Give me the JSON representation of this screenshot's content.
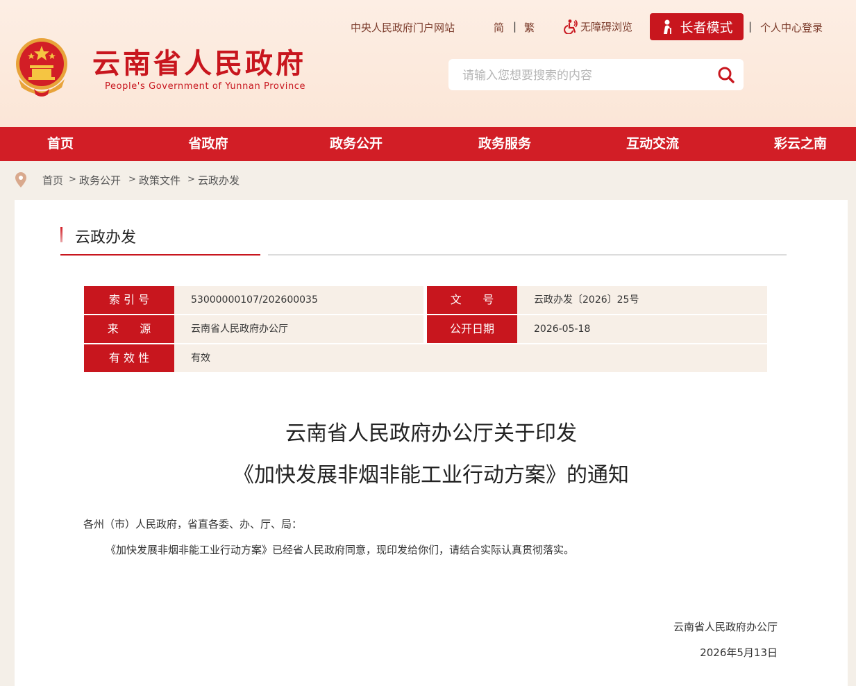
{
  "header": {
    "site_title": "云南省人民政府",
    "site_subtitle": "People's Government of Yunnan Province",
    "top_links": {
      "central_portal": "中央人民政府门户网站",
      "simplified": "简",
      "traditional": "繁",
      "accessibility": "无障碍浏览",
      "elder_mode": "长者模式",
      "login": "个人中心登录"
    },
    "search": {
      "placeholder": "请输入您想要搜索的内容",
      "value": ""
    }
  },
  "nav": {
    "items": [
      "首页",
      "省政府",
      "政务公开",
      "政务服务",
      "互动交流",
      "彩云之南"
    ]
  },
  "breadcrumb": [
    "首页",
    "政务公开",
    "政策文件",
    "云政办发"
  ],
  "column_title": "云政办发",
  "meta": {
    "index_label": "索 引 号",
    "index_value": "53000000107/202600035",
    "doc_no_label": "文      号",
    "doc_no_value": "云政办发〔2026〕25号",
    "source_label": "来      源",
    "source_value": "云南省人民政府办公厅",
    "date_label": "公开日期",
    "date_value": "2026-05-18",
    "validity_label": "有 效 性",
    "validity_value": "有效"
  },
  "document": {
    "title_line1": "云南省人民政府办公厅关于印发",
    "title_line2": "《加快发展非烟非能工业行动方案》的通知",
    "salutation": "各州（市）人民政府，省直各委、办、厅、局：",
    "paragraph1": "《加快发展非烟非能工业行动方案》已经省人民政府同意，现印发给你们，请结合实际认真贯彻落实。",
    "signer": "云南省人民政府办公厅",
    "sign_date": "2026年5月13日"
  },
  "colors": {
    "brand_red": "#c8161e",
    "nav_red": "#d21e26",
    "header_bg": "#fbe6d7",
    "meta_bg": "#f7efe7"
  },
  "icons": [
    "national-emblem-icon",
    "accessibility-icon",
    "elder-icon",
    "search-icon",
    "location-pin-icon"
  ]
}
